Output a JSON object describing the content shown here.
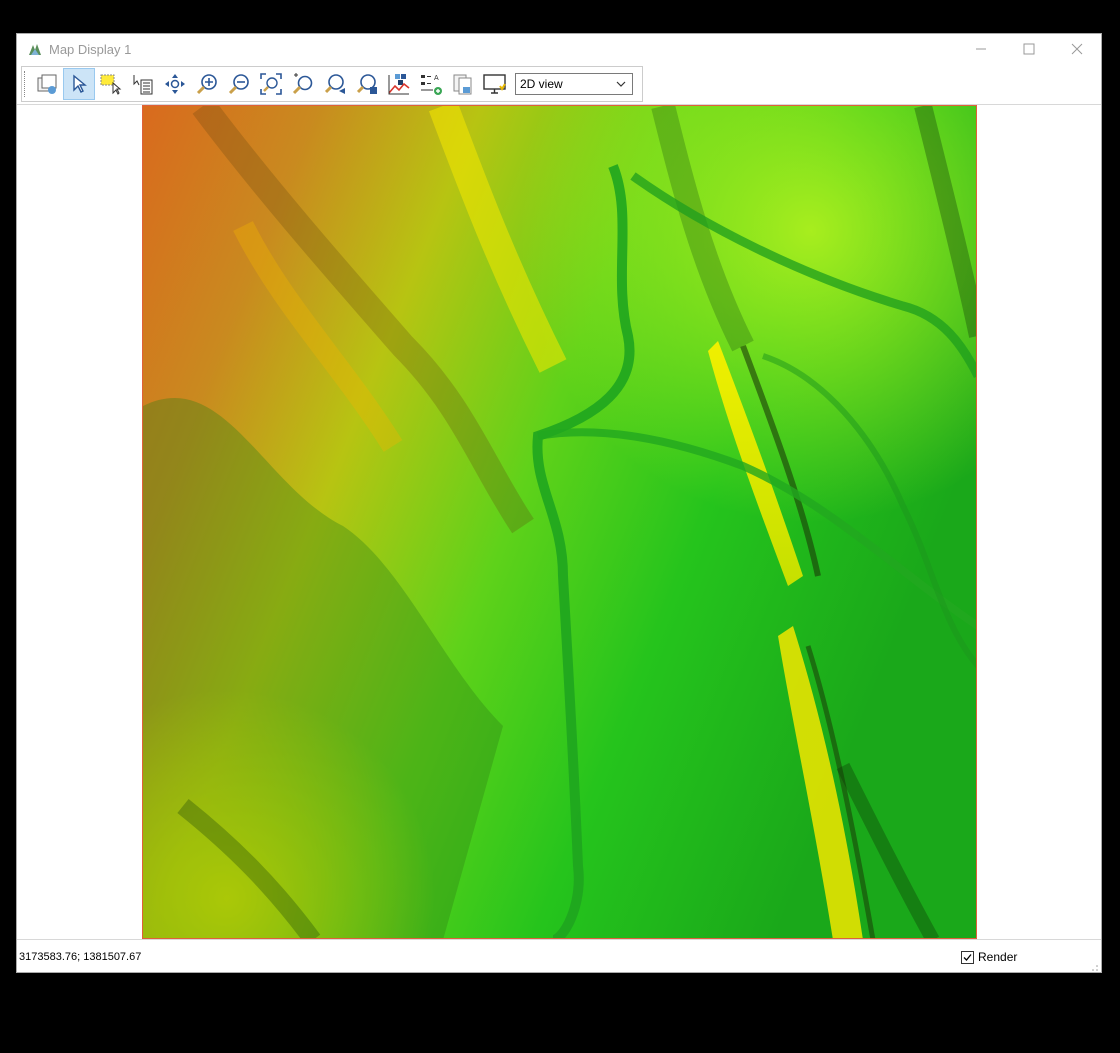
{
  "window": {
    "title": "Map Display 1"
  },
  "toolbar": {
    "buttons": [
      {
        "name": "layers-button",
        "icon": "layers-icon",
        "active": false
      },
      {
        "name": "select-pointer-button",
        "icon": "pointer-icon",
        "active": true
      },
      {
        "name": "rectangle-select-button",
        "icon": "rectangle-select-icon",
        "active": false
      },
      {
        "name": "identify-button",
        "icon": "identify-icon",
        "active": false
      },
      {
        "name": "pan-button",
        "icon": "pan-icon",
        "active": false
      },
      {
        "name": "zoom-in-button",
        "icon": "zoom-in-icon",
        "active": false
      },
      {
        "name": "zoom-out-button",
        "icon": "zoom-out-icon",
        "active": false
      },
      {
        "name": "zoom-extent-button",
        "icon": "zoom-extent-icon",
        "active": false
      },
      {
        "name": "zoom-window-button",
        "icon": "zoom-window-icon",
        "active": false
      },
      {
        "name": "zoom-previous-button",
        "icon": "zoom-previous-icon",
        "active": false
      },
      {
        "name": "zoom-next-button",
        "icon": "zoom-next-icon",
        "active": false
      },
      {
        "name": "profile-button",
        "icon": "profile-icon",
        "active": false
      },
      {
        "name": "legend-button",
        "icon": "legend-icon",
        "active": false
      },
      {
        "name": "copy-button",
        "icon": "copy-icon",
        "active": false
      },
      {
        "name": "display-button",
        "icon": "display-icon",
        "active": false
      }
    ],
    "view_select": {
      "value": "2D view"
    }
  },
  "status": {
    "coordinates": "3173583.76; 1381507.67",
    "render_label": "Render",
    "render_checked": true
  },
  "colors": {
    "map_border": "#e0603a",
    "active_button_bg": "#cce4f7"
  }
}
